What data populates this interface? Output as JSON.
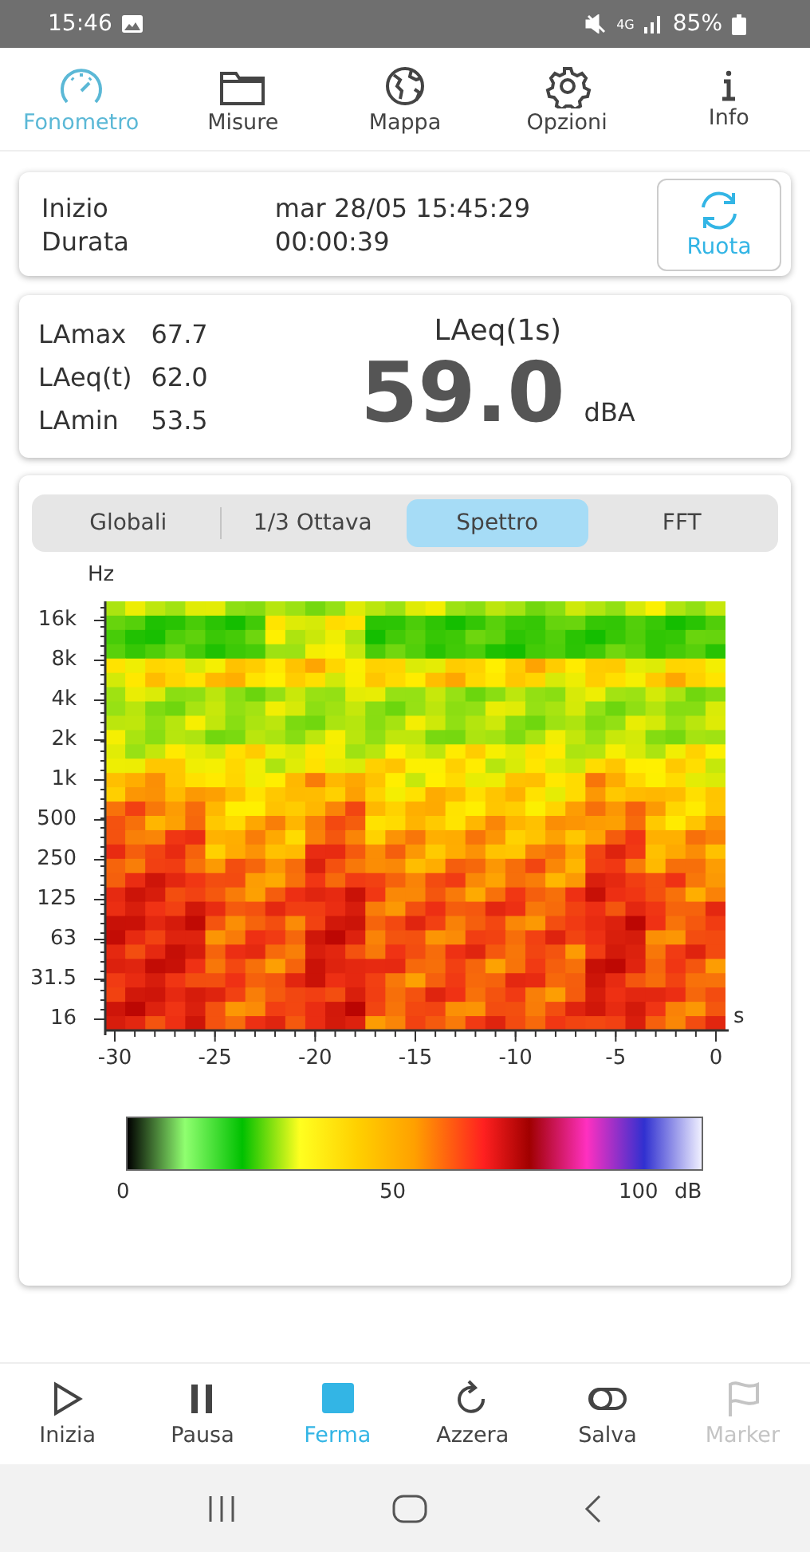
{
  "status_bar": {
    "time": "15:46",
    "network": "4G",
    "battery": "85%"
  },
  "top_tabs": [
    {
      "label": "Fonometro",
      "kind": "gauge",
      "selected": true
    },
    {
      "label": "Misure",
      "kind": "folder",
      "selected": false
    },
    {
      "label": "Mappa",
      "kind": "globe",
      "selected": false
    },
    {
      "label": "Opzioni",
      "kind": "gear",
      "selected": false
    },
    {
      "label": "Info",
      "kind": "info",
      "selected": false
    }
  ],
  "session": {
    "rows": [
      {
        "label": "Inizio",
        "value": "mar 28/05 15:45:29"
      },
      {
        "label": "Durata",
        "value": "00:00:39"
      }
    ],
    "button": "Ruota"
  },
  "levels": {
    "rows": [
      {
        "label": "LAmax",
        "value": "67.7"
      },
      {
        "label": "LAeq(t)",
        "value": "62.0"
      },
      {
        "label": "LAmin",
        "value": "53.5"
      }
    ],
    "main_label": "LAeq(1s)",
    "main_value": "59.0",
    "main_unit": "dBA"
  },
  "view_tabs": [
    {
      "label": "Globali",
      "selected": false
    },
    {
      "label": "1/3 Ottava",
      "selected": false
    },
    {
      "label": "Spettro",
      "selected": true
    },
    {
      "label": "FFT",
      "selected": false
    }
  ],
  "spectrogram": {
    "y_unit": "Hz",
    "y_labels": [
      "16k",
      "8k",
      "4k",
      "2k",
      "1k",
      "500",
      "250",
      "125",
      "63",
      "31.5",
      "16"
    ],
    "x_unit": "s",
    "x_labels": [
      "-30",
      "-25",
      "-20",
      "-15",
      "-10",
      "-5",
      "0"
    ],
    "scale_labels": [
      "0",
      "50",
      "100"
    ],
    "scale_unit": "dB"
  },
  "bottom_bar": [
    {
      "label": "Inizia",
      "kind": "play",
      "selected": false,
      "disabled": false
    },
    {
      "label": "Pausa",
      "kind": "pause",
      "selected": false,
      "disabled": false
    },
    {
      "label": "Ferma",
      "kind": "stop",
      "selected": true,
      "disabled": false
    },
    {
      "label": "Azzera",
      "kind": "reset",
      "selected": false,
      "disabled": false
    },
    {
      "label": "Salva",
      "kind": "toggle",
      "selected": false,
      "disabled": false
    },
    {
      "label": "Marker",
      "kind": "flag",
      "selected": false,
      "disabled": true
    }
  ]
}
